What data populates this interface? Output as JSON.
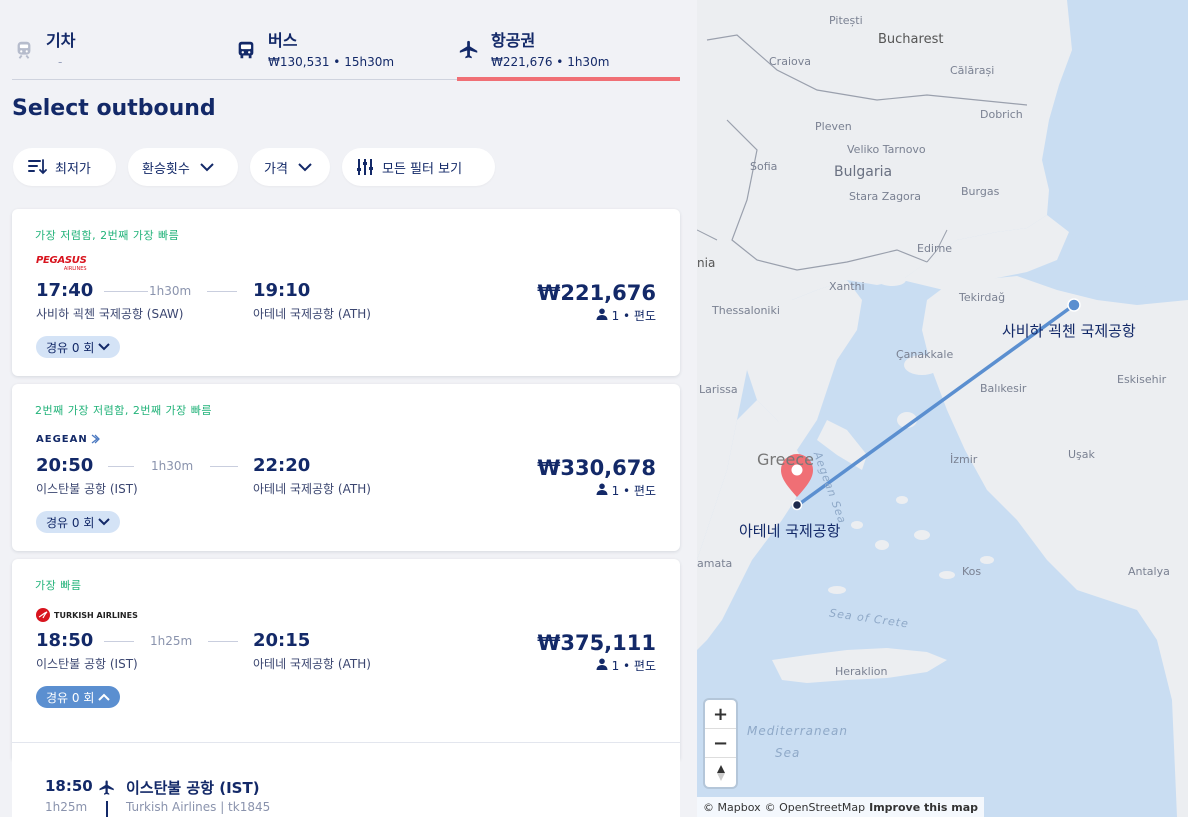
{
  "tabs": [
    {
      "name": "기차",
      "sub": "-",
      "icon": "train-icon"
    },
    {
      "name": "버스",
      "sub": "₩130,531 • 15h30m",
      "icon": "bus-icon"
    },
    {
      "name": "항공권",
      "sub": "₩221,676 • 1h30m",
      "icon": "plane-icon"
    }
  ],
  "section_title": "Select outbound",
  "filters": {
    "sort": "최저가",
    "transfers": "환승횟수",
    "price": "가격",
    "all_filters": "모든 필터 보기"
  },
  "flights": [
    {
      "tags": "가장 저렴함, 2번째 가장 빠름",
      "airline": "PEGASUS",
      "airline_sub": "AIRLINES",
      "dep_time": "17:40",
      "dep_airport": "사비하 괵첸 국제공항 (SAW)",
      "duration": "1h30m",
      "arr_time": "19:10",
      "arr_airport": "아테네 국제공항 (ATH)",
      "price": "₩221,676",
      "passengers": "1 • 편도",
      "stops": "경유 0 회"
    },
    {
      "tags": "2번째 가장 저렴함, 2번째 가장 빠름",
      "airline": "AEGEAN",
      "dep_time": "20:50",
      "dep_airport": "이스탄불 공항 (IST)",
      "duration": "1h30m",
      "arr_time": "22:20",
      "arr_airport": "아테네 국제공항 (ATH)",
      "price": "₩330,678",
      "passengers": "1 • 편도",
      "stops": "경유 0 회"
    },
    {
      "tags": "가장 빠름",
      "airline": "TURKISH AIRLINES",
      "dep_time": "18:50",
      "dep_airport": "이스탄불 공항 (IST)",
      "duration": "1h25m",
      "arr_time": "20:15",
      "arr_airport": "아테네 국제공항 (ATH)",
      "price": "₩375,111",
      "passengers": "1 • 편도",
      "stops": "경유 0 회"
    }
  ],
  "detail": {
    "time": "18:50",
    "duration": "1h25m",
    "airport": "이스탄불 공항 (IST)",
    "sub": "Turkish Airlines | tk1845"
  },
  "map": {
    "labels": {
      "pitesti": "Pitești",
      "bucharest": "Bucharest",
      "craiova": "Craiova",
      "calarasi": "Călărași",
      "dobrich": "Dobrich",
      "pleven": "Pleven",
      "veliko": "Veliko Tarnovo",
      "sofia": "Sofia",
      "bulgaria": "Bulgaria",
      "stara": "Stara Zagora",
      "burgas": "Burgas",
      "edirne": "Edirne",
      "nia": "nia",
      "xanthi": "Xanthi",
      "tekirdag": "Tekirdağ",
      "thessaloniki": "Thessaloniki",
      "canakkale": "Çanakkale",
      "larissa": "Larissa",
      "balikesir": "Balıkesir",
      "eskisehir": "Eskisehir",
      "greece": "Greece",
      "izmir": "İzmir",
      "usak": "Uşak",
      "aegean_sea": "Aegean Sea",
      "amata": "amata",
      "kos": "Kos",
      "antalya": "Antalya",
      "sea_crete": "Sea of Crete",
      "heraklion": "Heraklion",
      "med1": "Mediterranean",
      "med2": "Sea"
    },
    "origin_label": "사비하 괵첸 국제공항",
    "dest_label": "아테네 국제공항",
    "zoom_in": "+",
    "zoom_out": "−",
    "attribution": {
      "mapbox": "© Mapbox",
      "osm": "© OpenStreetMap",
      "improve": "Improve this map"
    },
    "colors": {
      "route": "#5b8fd0",
      "pin": "#f06f75",
      "water": "#c9ddf2",
      "land": "#eceef1"
    }
  }
}
